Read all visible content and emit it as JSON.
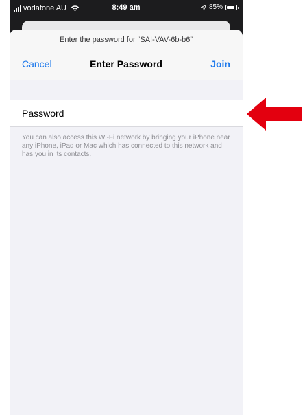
{
  "status_bar": {
    "carrier": "vodafone AU",
    "time": "8:49 am",
    "battery_percent": "85%",
    "battery_level": 0.85,
    "icons": [
      "signal-bars-icon",
      "wifi-icon",
      "location-arrow-icon",
      "battery-icon"
    ]
  },
  "sheet": {
    "prompt": "Enter the password for “SAI-VAV-6b-b6”",
    "cancel_label": "Cancel",
    "title": "Enter Password",
    "join_label": "Join"
  },
  "password_row": {
    "label": "Password",
    "value": ""
  },
  "help_text": "You can also access this Wi-Fi network by bringing your iPhone near any iPhone, iPad or Mac which has connected to this network and has you in its contacts.",
  "colors": {
    "accent": "#1f7aec",
    "arrow": "#e3000f",
    "sheet_background": "#f2f2f7"
  },
  "annotation": {
    "icon": "red-arrow-left-icon"
  }
}
